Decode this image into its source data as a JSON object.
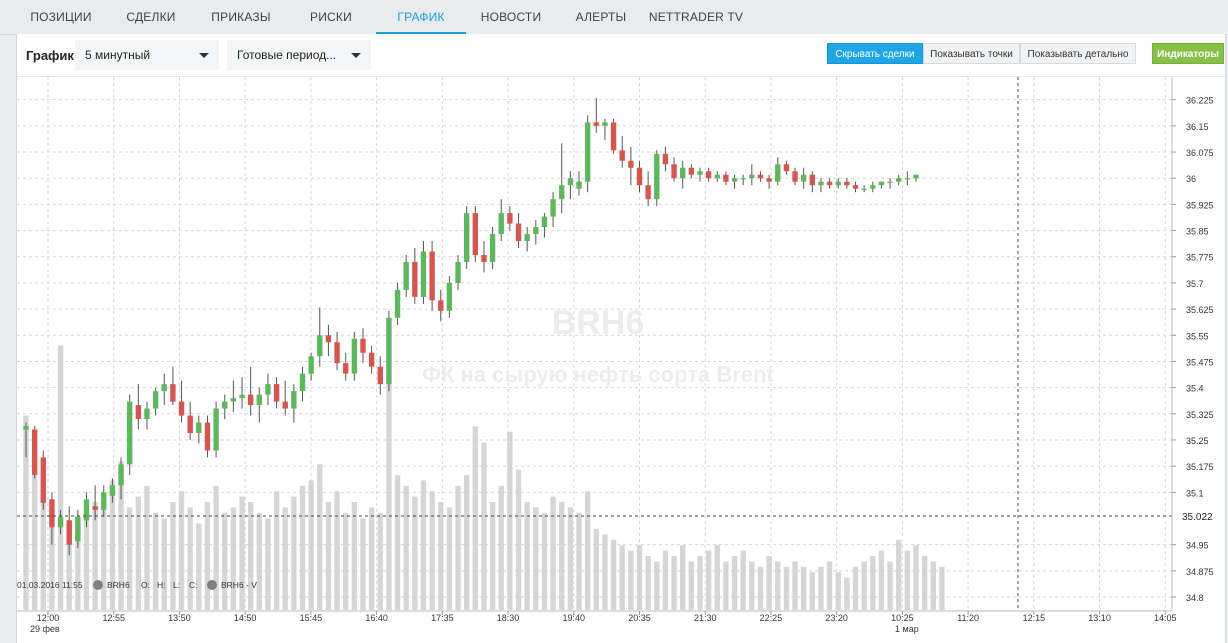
{
  "nav": {
    "tabs": [
      {
        "label": "ПОЗИЦИИ"
      },
      {
        "label": "СДЕЛКИ"
      },
      {
        "label": "ПРИКАЗЫ"
      },
      {
        "label": "РИСКИ"
      },
      {
        "label": "ГРАФИК"
      },
      {
        "label": "НОВОСТИ"
      },
      {
        "label": "АЛЕРТЫ"
      },
      {
        "label": "NETTRADER TV"
      }
    ],
    "active_tab": "ГРАФИК"
  },
  "toolbar": {
    "label": "График",
    "interval_value": "5 минутный",
    "period_value": "Готовые период...",
    "hide_trades_label": "Скрывать сделки",
    "show_points_label": "Показывать точки",
    "show_detail_label": "Показывать детально",
    "indicators_label": "Индикаторы"
  },
  "colors": {
    "accent": "#1ea6e8",
    "indicators": "#86c146",
    "up_candle": "#5cb85c",
    "down_candle": "#d9534f",
    "volume": "#cfcfcf"
  },
  "chart_data": {
    "type": "candlestick",
    "title": "BRH6",
    "subtitle": "ФК на сырую нефть сорта Brent",
    "price_tick_labels": [
      "36.225",
      "36.15",
      "36.075",
      "36",
      "35.925",
      "35.85",
      "35.775",
      "35.7",
      "35.625",
      "35.55",
      "35.475",
      "35.4",
      "35.325",
      "35.25",
      "35.175",
      "35.1",
      "34.95",
      "34.875",
      "34.8"
    ],
    "ylim": [
      34.76,
      36.29
    ],
    "current_price_label": "35.022",
    "current_price": 35.022,
    "time_tick_labels": [
      "12:00",
      "12:55",
      "13:50",
      "14:50",
      "15:45",
      "16:40",
      "17:35",
      "18:30",
      "19:40",
      "20:35",
      "21:30",
      "22:25",
      "23:20",
      "10:25",
      "11:20",
      "12:15",
      "13:10",
      "14:05"
    ],
    "date_labels": [
      "29 фев",
      "1 мар"
    ],
    "legend": {
      "date": "01.03.2016 11:55",
      "symbol": "BRH6",
      "o_label": "O:",
      "h_label": "H:",
      "l_label": "L:",
      "c_label": "C:",
      "volume_label": "BRH6 - V"
    },
    "grid": true,
    "candles": [
      {
        "o": 35.28,
        "h": 35.3,
        "l": 35.2,
        "c": 35.29
      },
      {
        "o": 35.28,
        "h": 35.29,
        "l": 35.14,
        "c": 35.15
      },
      {
        "o": 35.2,
        "h": 35.22,
        "l": 35.05,
        "c": 35.07
      },
      {
        "o": 35.08,
        "h": 35.1,
        "l": 34.95,
        "c": 35.0
      },
      {
        "o": 35.0,
        "h": 35.05,
        "l": 34.98,
        "c": 35.03
      },
      {
        "o": 35.02,
        "h": 35.06,
        "l": 34.92,
        "c": 34.95
      },
      {
        "o": 34.96,
        "h": 35.05,
        "l": 34.94,
        "c": 35.03
      },
      {
        "o": 35.02,
        "h": 35.1,
        "l": 35.0,
        "c": 35.08
      },
      {
        "o": 35.06,
        "h": 35.12,
        "l": 35.02,
        "c": 35.05
      },
      {
        "o": 35.05,
        "h": 35.12,
        "l": 35.03,
        "c": 35.1
      },
      {
        "o": 35.09,
        "h": 35.14,
        "l": 35.07,
        "c": 35.12
      },
      {
        "o": 35.12,
        "h": 35.2,
        "l": 35.08,
        "c": 35.18
      },
      {
        "o": 35.18,
        "h": 35.38,
        "l": 35.15,
        "c": 35.36
      },
      {
        "o": 35.35,
        "h": 35.41,
        "l": 35.28,
        "c": 35.31
      },
      {
        "o": 35.31,
        "h": 35.36,
        "l": 35.28,
        "c": 35.34
      },
      {
        "o": 35.34,
        "h": 35.4,
        "l": 35.32,
        "c": 35.39
      },
      {
        "o": 35.39,
        "h": 35.44,
        "l": 35.35,
        "c": 35.41
      },
      {
        "o": 35.41,
        "h": 35.46,
        "l": 35.35,
        "c": 35.36
      },
      {
        "o": 35.36,
        "h": 35.42,
        "l": 35.3,
        "c": 35.32
      },
      {
        "o": 35.32,
        "h": 35.36,
        "l": 35.25,
        "c": 35.27
      },
      {
        "o": 35.27,
        "h": 35.32,
        "l": 35.24,
        "c": 35.3
      },
      {
        "o": 35.3,
        "h": 35.32,
        "l": 35.2,
        "c": 35.22
      },
      {
        "o": 35.22,
        "h": 35.36,
        "l": 35.2,
        "c": 35.34
      },
      {
        "o": 35.34,
        "h": 35.38,
        "l": 35.31,
        "c": 35.36
      },
      {
        "o": 35.36,
        "h": 35.42,
        "l": 35.33,
        "c": 35.37
      },
      {
        "o": 35.37,
        "h": 35.43,
        "l": 35.34,
        "c": 35.38
      },
      {
        "o": 35.38,
        "h": 35.46,
        "l": 35.32,
        "c": 35.35
      },
      {
        "o": 35.35,
        "h": 35.4,
        "l": 35.3,
        "c": 35.38
      },
      {
        "o": 35.38,
        "h": 35.44,
        "l": 35.35,
        "c": 35.41
      },
      {
        "o": 35.41,
        "h": 35.43,
        "l": 35.34,
        "c": 35.36
      },
      {
        "o": 35.36,
        "h": 35.42,
        "l": 35.32,
        "c": 35.34
      },
      {
        "o": 35.34,
        "h": 35.41,
        "l": 35.3,
        "c": 35.39
      },
      {
        "o": 35.39,
        "h": 35.46,
        "l": 35.36,
        "c": 35.44
      },
      {
        "o": 35.44,
        "h": 35.5,
        "l": 35.42,
        "c": 35.49
      },
      {
        "o": 35.49,
        "h": 35.63,
        "l": 35.46,
        "c": 35.55
      },
      {
        "o": 35.55,
        "h": 35.58,
        "l": 35.49,
        "c": 35.53
      },
      {
        "o": 35.53,
        "h": 35.56,
        "l": 35.45,
        "c": 35.47
      },
      {
        "o": 35.47,
        "h": 35.5,
        "l": 35.42,
        "c": 35.44
      },
      {
        "o": 35.44,
        "h": 35.56,
        "l": 35.42,
        "c": 35.54
      },
      {
        "o": 35.54,
        "h": 35.57,
        "l": 35.47,
        "c": 35.5
      },
      {
        "o": 35.5,
        "h": 35.52,
        "l": 35.44,
        "c": 35.46
      },
      {
        "o": 35.46,
        "h": 35.49,
        "l": 35.38,
        "c": 35.41
      },
      {
        "o": 35.41,
        "h": 35.62,
        "l": 35.39,
        "c": 35.6
      },
      {
        "o": 35.6,
        "h": 35.7,
        "l": 35.58,
        "c": 35.68
      },
      {
        "o": 35.68,
        "h": 35.78,
        "l": 35.66,
        "c": 35.76
      },
      {
        "o": 35.76,
        "h": 35.8,
        "l": 35.64,
        "c": 35.66
      },
      {
        "o": 35.66,
        "h": 35.82,
        "l": 35.64,
        "c": 35.79
      },
      {
        "o": 35.79,
        "h": 35.82,
        "l": 35.62,
        "c": 35.65
      },
      {
        "o": 35.65,
        "h": 35.68,
        "l": 35.59,
        "c": 35.62
      },
      {
        "o": 35.62,
        "h": 35.72,
        "l": 35.6,
        "c": 35.7
      },
      {
        "o": 35.7,
        "h": 35.78,
        "l": 35.68,
        "c": 35.76
      },
      {
        "o": 35.76,
        "h": 35.92,
        "l": 35.74,
        "c": 35.9
      },
      {
        "o": 35.9,
        "h": 35.92,
        "l": 35.76,
        "c": 35.78
      },
      {
        "o": 35.78,
        "h": 35.82,
        "l": 35.73,
        "c": 35.76
      },
      {
        "o": 35.76,
        "h": 35.86,
        "l": 35.74,
        "c": 35.84
      },
      {
        "o": 35.84,
        "h": 35.94,
        "l": 35.82,
        "c": 35.9
      },
      {
        "o": 35.9,
        "h": 35.92,
        "l": 35.85,
        "c": 35.87
      },
      {
        "o": 35.87,
        "h": 35.9,
        "l": 35.8,
        "c": 35.82
      },
      {
        "o": 35.82,
        "h": 35.86,
        "l": 35.79,
        "c": 35.84
      },
      {
        "o": 35.84,
        "h": 35.88,
        "l": 35.81,
        "c": 35.86
      },
      {
        "o": 35.86,
        "h": 35.9,
        "l": 35.83,
        "c": 35.89
      },
      {
        "o": 35.89,
        "h": 35.96,
        "l": 35.86,
        "c": 35.94
      },
      {
        "o": 35.94,
        "h": 36.1,
        "l": 35.9,
        "c": 35.98
      },
      {
        "o": 35.98,
        "h": 36.02,
        "l": 35.94,
        "c": 36.0
      },
      {
        "o": 35.97,
        "h": 36.02,
        "l": 35.95,
        "c": 35.99
      },
      {
        "o": 35.99,
        "h": 36.18,
        "l": 35.96,
        "c": 36.16
      },
      {
        "o": 36.16,
        "h": 36.23,
        "l": 36.13,
        "c": 36.15
      },
      {
        "o": 36.15,
        "h": 36.17,
        "l": 36.11,
        "c": 36.16
      },
      {
        "o": 36.16,
        "h": 36.17,
        "l": 36.07,
        "c": 36.08
      },
      {
        "o": 36.08,
        "h": 36.12,
        "l": 36.03,
        "c": 36.05
      },
      {
        "o": 36.05,
        "h": 36.09,
        "l": 35.98,
        "c": 36.03
      },
      {
        "o": 36.03,
        "h": 36.05,
        "l": 35.96,
        "c": 35.98
      },
      {
        "o": 35.98,
        "h": 36.02,
        "l": 35.92,
        "c": 35.94
      },
      {
        "o": 35.94,
        "h": 36.08,
        "l": 35.92,
        "c": 36.07
      },
      {
        "o": 36.07,
        "h": 36.09,
        "l": 36.02,
        "c": 36.04
      },
      {
        "o": 36.04,
        "h": 36.06,
        "l": 35.99,
        "c": 36.0
      },
      {
        "o": 36.0,
        "h": 36.05,
        "l": 35.97,
        "c": 36.03
      },
      {
        "o": 36.03,
        "h": 36.04,
        "l": 36.0,
        "c": 36.01
      },
      {
        "o": 36.01,
        "h": 36.03,
        "l": 35.99,
        "c": 36.02
      },
      {
        "o": 36.02,
        "h": 36.03,
        "l": 35.99,
        "c": 36.0
      },
      {
        "o": 36.0,
        "h": 36.02,
        "l": 35.99,
        "c": 36.01
      },
      {
        "o": 36.01,
        "h": 36.02,
        "l": 35.98,
        "c": 35.99
      },
      {
        "o": 35.99,
        "h": 36.01,
        "l": 35.97,
        "c": 36.0
      },
      {
        "o": 36.0,
        "h": 36.01,
        "l": 35.98,
        "c": 36.0
      },
      {
        "o": 36.0,
        "h": 36.04,
        "l": 35.98,
        "c": 36.01
      },
      {
        "o": 36.01,
        "h": 36.02,
        "l": 35.99,
        "c": 36.0
      },
      {
        "o": 36.0,
        "h": 36.01,
        "l": 35.97,
        "c": 35.99
      },
      {
        "o": 35.99,
        "h": 36.06,
        "l": 35.98,
        "c": 36.04
      },
      {
        "o": 36.04,
        "h": 36.05,
        "l": 36.01,
        "c": 36.02
      },
      {
        "o": 36.02,
        "h": 36.03,
        "l": 35.98,
        "c": 35.99
      },
      {
        "o": 35.99,
        "h": 36.03,
        "l": 35.97,
        "c": 36.01
      },
      {
        "o": 36.01,
        "h": 36.02,
        "l": 35.96,
        "c": 35.98
      },
      {
        "o": 35.98,
        "h": 36.0,
        "l": 35.96,
        "c": 35.99
      },
      {
        "o": 35.99,
        "h": 36.0,
        "l": 35.97,
        "c": 35.98
      },
      {
        "o": 35.98,
        "h": 36.0,
        "l": 35.97,
        "c": 35.99
      },
      {
        "o": 35.99,
        "h": 36.0,
        "l": 35.97,
        "c": 35.98
      },
      {
        "o": 35.98,
        "h": 35.99,
        "l": 35.96,
        "c": 35.97
      },
      {
        "o": 35.97,
        "h": 35.98,
        "l": 35.96,
        "c": 35.97
      },
      {
        "o": 35.97,
        "h": 35.99,
        "l": 35.96,
        "c": 35.98
      },
      {
        "o": 35.98,
        "h": 35.99,
        "l": 35.97,
        "c": 35.99
      },
      {
        "o": 35.99,
        "h": 36.0,
        "l": 35.97,
        "c": 35.99
      },
      {
        "o": 35.99,
        "h": 36.01,
        "l": 35.98,
        "c": 36.0
      },
      {
        "o": 36.0,
        "h": 36.02,
        "l": 35.98,
        "c": 36.0
      },
      {
        "o": 36.0,
        "h": 36.01,
        "l": 35.99,
        "c": 36.01
      }
    ],
    "volumes": [
      72,
      55,
      42,
      38,
      98,
      30,
      34,
      36,
      40,
      38,
      48,
      55,
      38,
      42,
      46,
      36,
      34,
      40,
      44,
      38,
      32,
      40,
      46,
      36,
      38,
      42,
      40,
      36,
      34,
      44,
      38,
      42,
      46,
      48,
      54,
      40,
      44,
      36,
      40,
      34,
      38,
      36,
      88,
      50,
      46,
      42,
      48,
      44,
      40,
      38,
      46,
      50,
      68,
      62,
      40,
      46,
      66,
      52,
      40,
      38,
      36,
      42,
      40,
      38,
      36,
      44,
      30,
      28,
      26,
      24,
      22,
      24,
      20,
      18,
      22,
      20,
      24,
      18,
      20,
      22,
      24,
      18,
      20,
      22,
      18,
      16,
      20,
      18,
      16,
      18,
      16,
      14,
      16,
      18,
      14,
      12,
      16,
      18,
      20,
      22,
      18,
      26,
      22,
      24,
      20,
      18,
      16
    ]
  }
}
